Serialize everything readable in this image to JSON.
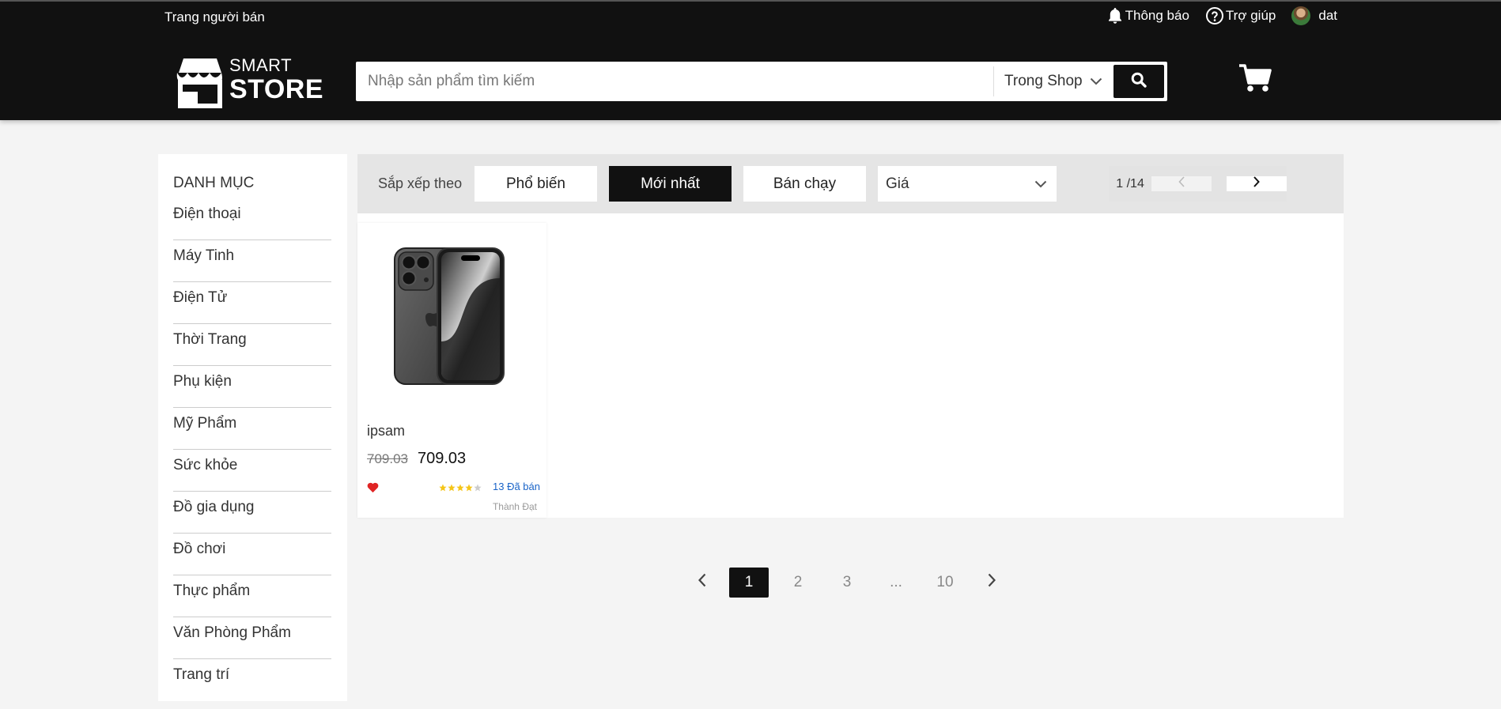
{
  "header": {
    "seller_link": "Trang người bán",
    "notifications": "Thông báo",
    "help": "Trợ giúp",
    "username": "dat",
    "logo": {
      "line1": "SMART",
      "line2": "STORE"
    },
    "search": {
      "placeholder": "Nhập sản phẩm tìm kiếm",
      "value": "",
      "scope": "Trong Shop"
    }
  },
  "sidebar": {
    "title": "DANH MỤC",
    "items": [
      "Điện thoại",
      "Máy Tinh",
      "Điện Tử",
      "Thời Trang",
      "Phụ kiện",
      "Mỹ Phẩm",
      "Sức khỏe",
      "Đồ gia dụng",
      "Đồ chơi",
      "Thực phẩm",
      "Văn Phòng Phẩm",
      "Trang trí"
    ]
  },
  "sort": {
    "label": "Sắp xếp theo",
    "options": [
      "Phổ biến",
      "Mới nhất",
      "Bán chạy"
    ],
    "active": "Mới nhất",
    "price_select": "Giá",
    "page_indicator": "1 /14"
  },
  "products": [
    {
      "name": "ipsam",
      "price_old": "709.03",
      "price_new": "709.03",
      "rating": 4,
      "sold": "13 Đã bán",
      "shop": "Thành Đạt"
    }
  ],
  "pagination": {
    "pages": [
      "1",
      "2",
      "3",
      "...",
      "10"
    ],
    "active": "1"
  },
  "colors": {
    "header_bg": "#111111",
    "accent": "#111111",
    "star": "#f5c518",
    "heart": "#e02424",
    "sold_text": "#1a64c8"
  }
}
